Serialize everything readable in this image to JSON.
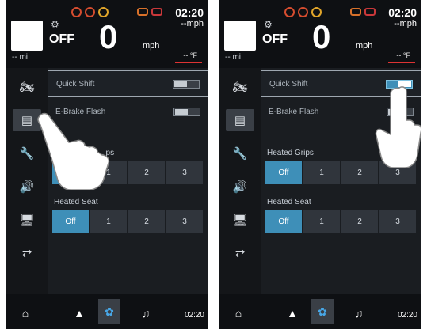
{
  "screens": [
    {
      "id": "left",
      "header": {
        "time": "02:20",
        "speed_unit_top": "--mph",
        "gear_state": "OFF",
        "speed": "0",
        "speed_unit": "mph",
        "odometer": "-- mi",
        "temperature": "-- °F"
      },
      "sidebar": [
        "motorcycle-icon",
        "settings-panel-icon",
        "wrench-icon",
        "speaker-icon",
        "display-icon",
        "sliders-icon"
      ],
      "active_sidebar": 1,
      "settings": {
        "quick_shift": {
          "label": "Quick Shift",
          "state": "off"
        },
        "ebrake_flash": {
          "label": "E-Brake Flash",
          "state": "off"
        },
        "heated_grips": {
          "label": "...ips",
          "options": [
            "",
            "1",
            "2",
            "3"
          ],
          "selected": 0
        },
        "heated_seat": {
          "label": "Heated Seat",
          "options": [
            "Off",
            "1",
            "2",
            "3"
          ],
          "selected": 0
        }
      },
      "bottom_bar": {
        "tabs": [
          "home-icon",
          "navigation-icon",
          "settings-gear-icon",
          "music-icon"
        ],
        "active_tab": 2,
        "time": "02:20"
      }
    },
    {
      "id": "right",
      "header": {
        "time": "02:20",
        "speed_unit_top": "--mph",
        "gear_state": "OFF",
        "speed": "0",
        "speed_unit": "mph",
        "odometer": "-- mi",
        "temperature": "-- °F"
      },
      "sidebar": [
        "motorcycle-icon",
        "settings-panel-icon",
        "wrench-icon",
        "speaker-icon",
        "display-icon",
        "sliders-icon"
      ],
      "active_sidebar": 1,
      "settings": {
        "quick_shift": {
          "label": "Quick Shift",
          "state": "on"
        },
        "ebrake_flash": {
          "label": "E-Brake Flash",
          "state": "off"
        },
        "heated_grips": {
          "label": "Heated Grips",
          "options": [
            "Off",
            "1",
            "2",
            "3"
          ],
          "selected": 0
        },
        "heated_seat": {
          "label": "Heated Seat",
          "options": [
            "Off",
            "1",
            "2",
            "3"
          ],
          "selected": 0
        }
      },
      "bottom_bar": {
        "tabs": [
          "home-icon",
          "navigation-icon",
          "settings-gear-icon",
          "music-icon"
        ],
        "active_tab": 2,
        "time": "02:20"
      }
    }
  ],
  "colors": {
    "accent": "#3e8fb8",
    "background": "#1a1d21",
    "warning_red": "#d64d2f",
    "warning_amber": "#e0a52a"
  }
}
